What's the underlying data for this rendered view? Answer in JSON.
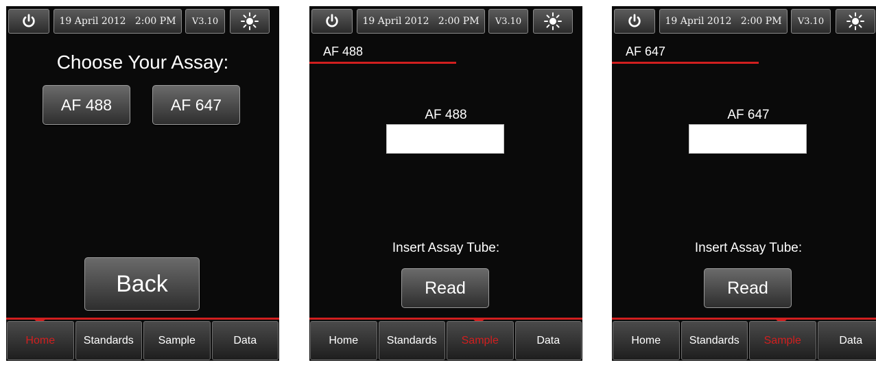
{
  "status_bar": {
    "date_time": "19 April 2012   2:00 PM",
    "version": "V3.10",
    "power_icon": "power-icon",
    "brightness_icon": "sun-icon"
  },
  "colors": {
    "accent": "#d11f1f",
    "background": "#0a0a0a",
    "button_text": "#ffffff"
  },
  "screens": [
    {
      "title": "Choose Your Assay:",
      "assay_buttons": [
        "AF 488",
        "AF 647"
      ],
      "back_label": "Back",
      "active_tab": "Home"
    },
    {
      "assay_name": "AF 488",
      "field_label": "AF 488",
      "field_value": "",
      "insert_label": "Insert Assay Tube:",
      "read_label": "Read",
      "active_tab": "Sample"
    },
    {
      "assay_name": "AF 647",
      "field_label": "AF 647",
      "field_value": "",
      "insert_label": "Insert Assay Tube:",
      "read_label": "Read",
      "active_tab": "Sample"
    }
  ],
  "nav_tabs": [
    "Home",
    "Standards",
    "Sample",
    "Data"
  ]
}
